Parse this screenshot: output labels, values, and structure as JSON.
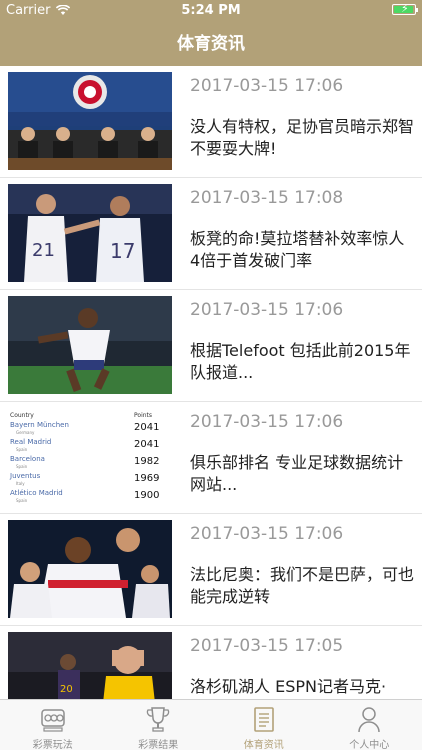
{
  "status_bar": {
    "carrier": "Carrier",
    "time": "5:24 PM",
    "battery_level": 0.95
  },
  "nav": {
    "title": "体育资讯"
  },
  "news": [
    {
      "time": "2017-03-15 17:06",
      "title": "没人有特权，足协官员暗示郑智不要耍大牌!",
      "thumb": "press-conference"
    },
    {
      "time": "2017-03-15 17:08",
      "title": "板凳的命!莫拉塔替补效率惊人 4倍于首发破门率",
      "thumb": "players-celebrating"
    },
    {
      "time": "2017-03-15 17:06",
      "title": "根据Telefoot 包括此前2015年队报道...",
      "thumb": "player-running"
    },
    {
      "time": "2017-03-15 17:06",
      "title": "俱乐部排名 专业足球数据统计网站...",
      "thumb": "ranking-table",
      "ranking": {
        "headers": [
          "Country",
          "Points"
        ],
        "rows": [
          {
            "club": "Bayern München",
            "country": "Germany",
            "points": "2041"
          },
          {
            "club": "Real Madrid",
            "country": "Spain",
            "points": "2041"
          },
          {
            "club": "Barcelona",
            "country": "Spain",
            "points": "1982"
          },
          {
            "club": "Juventus",
            "country": "Italy",
            "points": "1969"
          },
          {
            "club": "Atlético Madrid",
            "country": "Spain",
            "points": "1900"
          }
        ]
      }
    },
    {
      "time": "2017-03-15 17:06",
      "title": "法比尼奥：我们不是巴萨，可也能完成逆转",
      "thumb": "team-celebration"
    },
    {
      "time": "2017-03-15 17:05",
      "title": "洛杉矶湖人 ESPN记者马克·",
      "thumb": "basketball-player"
    }
  ],
  "tabs": [
    {
      "label": "彩票玩法",
      "icon": "lottery-icon",
      "active": false
    },
    {
      "label": "彩票结果",
      "icon": "trophy-icon",
      "active": false
    },
    {
      "label": "体育资讯",
      "icon": "news-icon",
      "active": true
    },
    {
      "label": "个人中心",
      "icon": "person-icon",
      "active": false
    }
  ],
  "colors": {
    "brand": "#b2a178",
    "time_text": "#999999",
    "title_text": "#222222"
  }
}
